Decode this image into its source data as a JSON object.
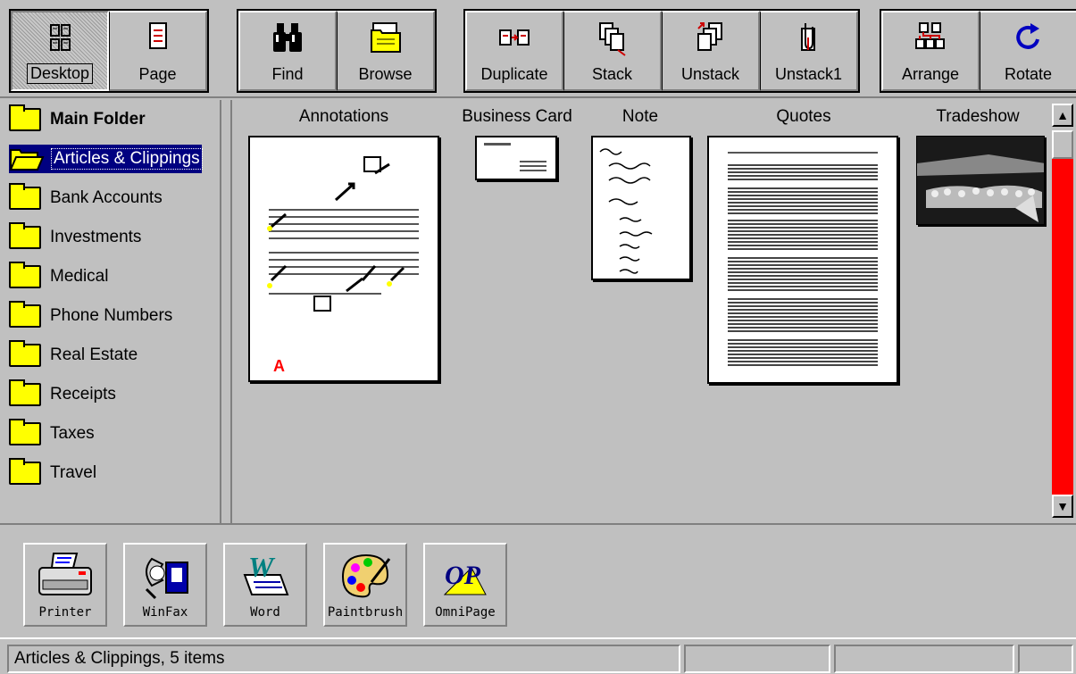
{
  "toolbar": {
    "desktop": "Desktop",
    "page": "Page",
    "find": "Find",
    "browse": "Browse",
    "duplicate": "Duplicate",
    "stack": "Stack",
    "unstack": "Unstack",
    "unstack1": "Unstack1",
    "arrange": "Arrange",
    "rotate": "Rotate"
  },
  "folders": [
    {
      "label": "Main Folder"
    },
    {
      "label": "Articles & Clippings"
    },
    {
      "label": "Bank Accounts"
    },
    {
      "label": "Investments"
    },
    {
      "label": "Medical"
    },
    {
      "label": "Phone Numbers"
    },
    {
      "label": "Real Estate"
    },
    {
      "label": "Receipts"
    },
    {
      "label": "Taxes"
    },
    {
      "label": "Travel"
    }
  ],
  "documents": [
    {
      "title": "Annotations"
    },
    {
      "title": "Business Card"
    },
    {
      "title": "Note"
    },
    {
      "title": "Quotes"
    },
    {
      "title": "Tradeshow"
    }
  ],
  "apps": [
    {
      "label": "Printer"
    },
    {
      "label": "WinFax"
    },
    {
      "label": "Word"
    },
    {
      "label": "Paintbrush"
    },
    {
      "label": "OmniPage"
    }
  ],
  "status": {
    "text": "Articles & Clippings, 5 items"
  },
  "colors": {
    "selection": "#000080",
    "folder": "#ffff00",
    "scroll_track": "#ff0000",
    "face": "#c0c0c0"
  }
}
